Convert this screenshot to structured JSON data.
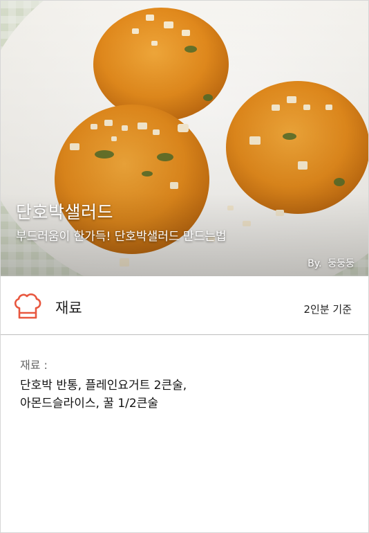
{
  "hero": {
    "title": "단호박샐러드",
    "subtitle": "부드러움이 한가득! 단호박샐러드 만드는법",
    "author": "By.  둥둥둥"
  },
  "ingredients": {
    "icon": "chef-hat-icon",
    "header": "재료",
    "serving": "2인분 기준",
    "label": "재료 :",
    "lines": [
      "단호박 반통, 플레인요거트 2큰술,",
      "아몬드슬라이스, 꿀 1/2큰술"
    ]
  },
  "colors": {
    "accent": "#e8573f"
  }
}
